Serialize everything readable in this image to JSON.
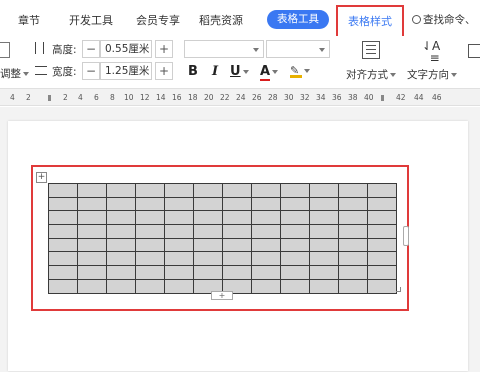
{
  "tabs": {
    "items": [
      "章节",
      "开发工具",
      "会员专享",
      "稻壳资源"
    ],
    "table_tools": "表格工具",
    "table_style": "表格样式",
    "search": "查找命令、"
  },
  "ribbon": {
    "adjust_label": "调整",
    "height_label": "高度:",
    "height_value": "0.55厘米",
    "width_label": "宽度:",
    "width_value": "1.25厘米",
    "minus": "−",
    "plus": "+",
    "bold": "B",
    "italic": "I",
    "underline": "U",
    "font_color": "A",
    "align_label": "对齐方式",
    "text_direction_label": "文字方向"
  },
  "ruler": {
    "labels": [
      "4",
      "2",
      "2",
      "4",
      "6",
      "8",
      "10",
      "12",
      "14",
      "16",
      "18",
      "20",
      "22",
      "24",
      "26",
      "28",
      "30",
      "32",
      "34",
      "36",
      "38",
      "40",
      "42",
      "44",
      "46"
    ]
  },
  "table": {
    "rows": 8,
    "cols": 12,
    "add_button": "+"
  },
  "colors": {
    "accent": "#3a78f2",
    "highlight": "#e03a3a",
    "cell": "#d3d3d3"
  }
}
